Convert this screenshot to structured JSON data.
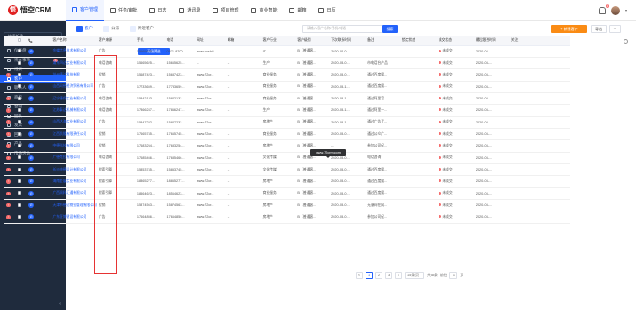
{
  "app": {
    "logo_text": "悟空CRM",
    "logo_mark": "悟"
  },
  "nav": [
    {
      "label": "客户管理",
      "icon": "customer-icon"
    },
    {
      "label": "任务/审批",
      "icon": "task-icon"
    },
    {
      "label": "日志",
      "icon": "log-icon"
    },
    {
      "label": "通讯录",
      "icon": "contacts-icon"
    },
    {
      "label": "项目管理",
      "icon": "project-icon"
    },
    {
      "label": "商业智能",
      "icon": "bi-icon"
    },
    {
      "label": "邮箱",
      "icon": "mail-icon"
    },
    {
      "label": "日历",
      "icon": "calendar-icon"
    }
  ],
  "top_right": {
    "notice_badge": "8"
  },
  "sidebar": {
    "quick_create": "快速新建",
    "items": [
      {
        "label": "仪表盘"
      },
      {
        "label": "待办事项",
        "badge": "1"
      },
      {
        "label": "线索"
      },
      {
        "label": "客户"
      },
      {
        "label": "联系人"
      },
      {
        "label": "商机"
      },
      {
        "label": "合同"
      },
      {
        "label": "回款"
      },
      {
        "label": "发票"
      },
      {
        "label": "回访"
      },
      {
        "label": "产品"
      },
      {
        "label": "市场活动"
      }
    ]
  },
  "tabs": [
    {
      "label": "客户"
    },
    {
      "label": "公海"
    },
    {
      "label": "附近客户"
    }
  ],
  "search": {
    "placeholder": "请输入客户名称/手机/电话",
    "button": "搜索"
  },
  "actions": {
    "new": "+ 新建客户",
    "import": "导出",
    "more": "···"
  },
  "scene": {
    "label": "场景：",
    "value": "我"
  },
  "filter_button": "高级筛选",
  "table": {
    "headers": [
      "客户名称",
      "客户来源",
      "手机",
      "电话",
      "网址",
      "邮箱",
      "客户行业",
      "客户级别",
      "下次联系时间",
      "备注",
      "锁定状态",
      "成交状态",
      "最后跟进时间",
      "关注"
    ],
    "rows": [
      {
        "name": "金蝶信息技术有限公司",
        "source": "广告",
        "mobile": "15665625...",
        "phone": "0571-8700...",
        "website": "www.xxshili...",
        "email": "--",
        "industry": "IT",
        "level": "B（普通客...",
        "next": "2020-04-0...",
        "remark": "--",
        "deal": "未成交",
        "last": "2020-04-...",
        "dot": false
      },
      {
        "name": "浦东四达实业有限公司",
        "source": "电话咨询",
        "mobile": "15665625...",
        "phone": "15665625...",
        "website": "--",
        "email": "--",
        "industry": "生产",
        "level": "B（普通客...",
        "next": "2020-03-0...",
        "remark": "市电话台产品",
        "deal": "未成交",
        "last": "2020-03-...",
        "dot": false
      },
      {
        "name": "苏州德达科技有限",
        "source": "促销",
        "mobile": "15687423...",
        "phone": "15687423...",
        "website": "www.72cr...",
        "email": "--",
        "industry": "商业服务",
        "level": "B（普通客...",
        "next": "2020-03-0...",
        "remark": "通过百度搜...",
        "deal": "未成交",
        "last": "2020-03-...",
        "dot": true
      },
      {
        "name": "山西同德经济贸易有限公司",
        "source": "广告",
        "mobile": "17733659...",
        "phone": "17733659...",
        "website": "www.72cr...",
        "email": "--",
        "industry": "商业服务",
        "level": "B（普通客...",
        "next": "2020-03-1...",
        "remark": "通过百度搜...",
        "deal": "未成交",
        "last": "2020-03-...",
        "dot": false
      },
      {
        "name": "辽宁德保实业有限公司",
        "source": "电话咨询",
        "mobile": "15842133...",
        "phone": "15842133...",
        "website": "www.72cr...",
        "email": "--",
        "industry": "商业服务",
        "level": "B（普通客...",
        "next": "2020-03-1...",
        "remark": "通过阿里官...",
        "deal": "未成交",
        "last": "2020-03-...",
        "dot": true
      },
      {
        "name": "江苏泰达机械有限公司",
        "source": "电话咨询",
        "mobile": "17866247...",
        "phone": "17866247...",
        "website": "www.72cr...",
        "email": "--",
        "industry": "生产",
        "level": "B（普通客...",
        "next": "2020-03-1...",
        "remark": "通过阿里一...",
        "deal": "未成交",
        "last": "2020-03-...",
        "dot": true
      },
      {
        "name": "山西达海实业有限公司",
        "source": "广告",
        "mobile": "15847232...",
        "phone": "15847232...",
        "website": "www.72cr...",
        "email": "--",
        "industry": "房地产",
        "level": "B（普通客...",
        "next": "2020-03-1...",
        "remark": "通过广告了...",
        "deal": "未成交",
        "last": "2020-03-...",
        "dot": true
      },
      {
        "name": "江西凯隆有限责任公司",
        "source": "促销",
        "mobile": "17665745...",
        "phone": "17665745...",
        "website": "www.72cr...",
        "email": "--",
        "industry": "商业服务",
        "level": "B（普通客...",
        "next": "2020-03-0...",
        "remark": "通过公众广...",
        "deal": "未成交",
        "last": "2020-03-...",
        "dot": true
      },
      {
        "name": "中德科技有限公司",
        "source": "促销",
        "mobile": "17683254...",
        "phone": "17683254...",
        "website": "www.72cr...",
        "email": "--",
        "industry": "房地产",
        "level": "B（普通客...",
        "next": "--",
        "remark": "参加公司促...",
        "deal": "未成交",
        "last": "2020-03-...",
        "dot": true
      },
      {
        "name": "广德克拉有限公司",
        "source": "电话咨询",
        "mobile": "17685466...",
        "phone": "17685466...",
        "website": "www.72cr...",
        "email": "--",
        "industry": "文化传媒",
        "level": "B（普通客...",
        "next": "2020-03-0...",
        "remark": "电话咨询",
        "deal": "未成交",
        "last": "2020-03-...",
        "dot": true
      },
      {
        "name": "长沙迪德设计有限公司",
        "source": "搜索引擎",
        "mobile": "15853745...",
        "phone": "15853745...",
        "website": "www.72cr...",
        "email": "--",
        "industry": "文化传媒",
        "level": "B（普通客...",
        "next": "2020-03-0...",
        "remark": "通过百度搜...",
        "deal": "未成交",
        "last": "2020-03-...",
        "dot": true
      },
      {
        "name": "海南金展实业有限公司",
        "source": "搜索引擎",
        "mobile": "18865277...",
        "phone": "18865277...",
        "website": "www.72cr...",
        "email": "--",
        "industry": "房地产",
        "level": "B（普通客...",
        "next": "2020-03-0...",
        "remark": "通过百度搜...",
        "deal": "未成交",
        "last": "2020-03-...",
        "dot": true
      },
      {
        "name": "广西润科汇通有限公司",
        "source": "搜索引擎",
        "mobile": "18564623...",
        "phone": "18564623...",
        "website": "www.72cr...",
        "email": "--",
        "industry": "商业服务",
        "level": "B（普通客...",
        "next": "2020-03-0...",
        "remark": "通过百度搜...",
        "deal": "未成交",
        "last": "2020-03-...",
        "dot": true
      },
      {
        "name": "天津市德达物业管理有限公司",
        "source": "促销",
        "mobile": "15874563...",
        "phone": "15874563...",
        "website": "www.72cr...",
        "email": "--",
        "industry": "房地产",
        "level": "B（普通客...",
        "next": "2020-03-0...",
        "remark": "无意间在网...",
        "deal": "未成交",
        "last": "2020-03-...",
        "dot": true
      },
      {
        "name": "广东亚博建设有限公司",
        "source": "广告",
        "mobile": "17664856...",
        "phone": "17664856...",
        "website": "www.72cr...",
        "email": "--",
        "industry": "房地产",
        "level": "B（普通客...",
        "next": "2020-03-0...",
        "remark": "参加公司促...",
        "deal": "未成交",
        "last": "2020-03-...",
        "dot": true
      }
    ]
  },
  "tooltip": "www.72crm.com",
  "pager": {
    "pages": [
      "<",
      "1",
      "2",
      "3",
      ">"
    ],
    "size": "15条/页",
    "total": "共38条",
    "goto": "前往",
    "jump": "1",
    "unit": "页"
  },
  "colors": {
    "primary": "#2362fb",
    "sidebar": "#1f2b3d",
    "orange": "#fa8b14",
    "red": "#f56c6c"
  }
}
